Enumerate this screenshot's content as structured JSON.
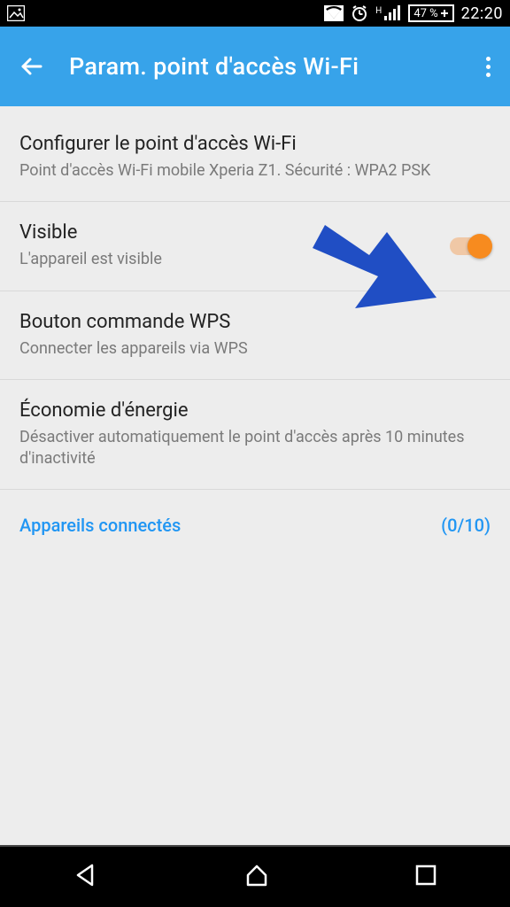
{
  "status": {
    "battery": "47 %",
    "time": "22:20",
    "network_indicator": "H"
  },
  "header": {
    "title": "Param. point d'accès Wi-Fi"
  },
  "items": {
    "configure": {
      "title": "Configurer le point d'accès Wi-Fi",
      "sub": "Point d'accès Wi-Fi mobile Xperia Z1. Sécurité : WPA2 PSK"
    },
    "visible": {
      "title": "Visible",
      "sub": "L'appareil est visible"
    },
    "wps": {
      "title": "Bouton commande WPS",
      "sub": "Connecter les appareils via WPS"
    },
    "power": {
      "title": "Économie d'énergie",
      "sub": "Désactiver automatiquement le point d'accès après 10 minutes d'inactivité"
    }
  },
  "connected": {
    "label": "Appareils connectés",
    "count": "(0/10)"
  }
}
